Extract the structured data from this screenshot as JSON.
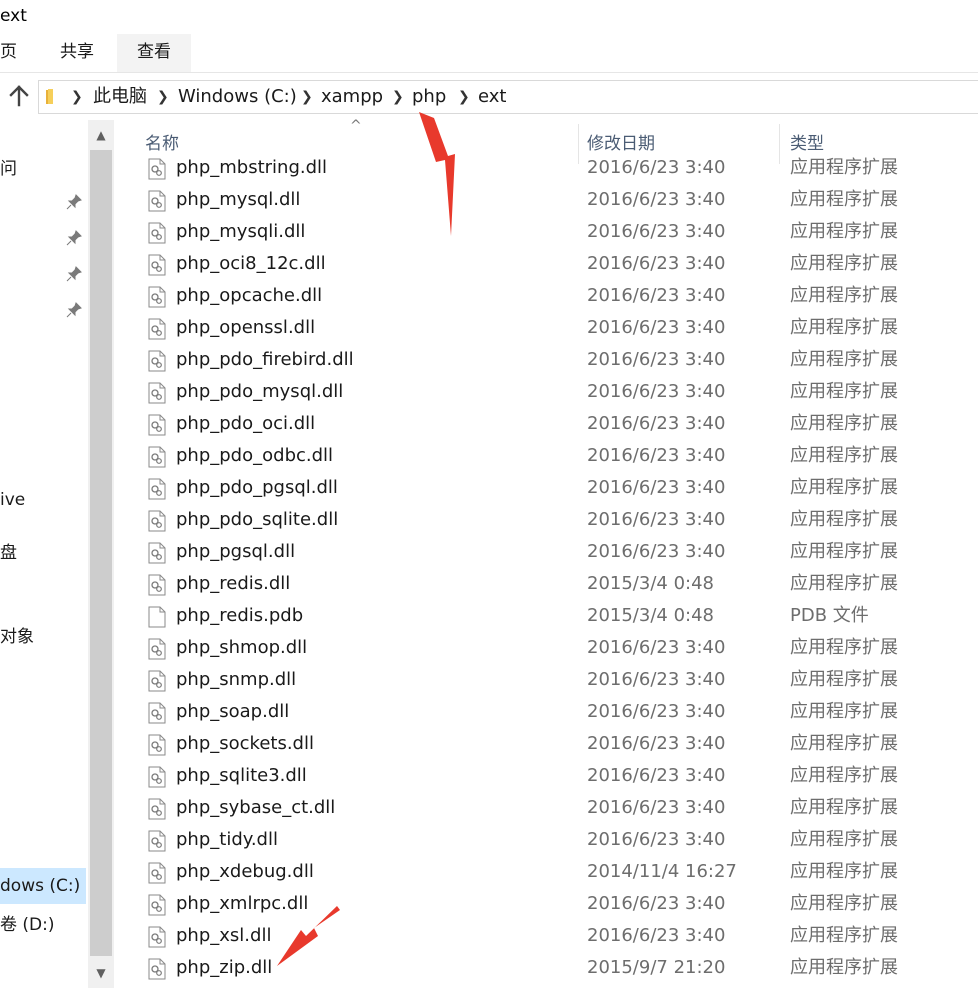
{
  "window": {
    "title": "ext"
  },
  "ribbon": {
    "tabs": [
      {
        "label": "页"
      },
      {
        "label": "共享"
      },
      {
        "label": "查看"
      }
    ]
  },
  "address": {
    "crumbs": [
      {
        "label": "此电脑"
      },
      {
        "label": "Windows (C:)"
      },
      {
        "label": "xampp"
      },
      {
        "label": "php"
      },
      {
        "label": "ext"
      }
    ]
  },
  "sidebar": {
    "items": [
      {
        "label": "问"
      },
      {
        "label": "ive"
      },
      {
        "label": "盘"
      },
      {
        "label": "对象"
      },
      {
        "label": "dows (C:)"
      },
      {
        "label": "卷 (D:)"
      }
    ]
  },
  "columns": {
    "name": "名称",
    "date": "修改日期",
    "type": "类型"
  },
  "files": [
    {
      "name": "php_mbstring.dll",
      "date": "2016/6/23 3:40",
      "type": "应用程序扩展",
      "icon": "dll-file-icon"
    },
    {
      "name": "php_mysql.dll",
      "date": "2016/6/23 3:40",
      "type": "应用程序扩展",
      "icon": "dll-file-icon"
    },
    {
      "name": "php_mysqli.dll",
      "date": "2016/6/23 3:40",
      "type": "应用程序扩展",
      "icon": "dll-file-icon"
    },
    {
      "name": "php_oci8_12c.dll",
      "date": "2016/6/23 3:40",
      "type": "应用程序扩展",
      "icon": "dll-file-icon"
    },
    {
      "name": "php_opcache.dll",
      "date": "2016/6/23 3:40",
      "type": "应用程序扩展",
      "icon": "dll-file-icon"
    },
    {
      "name": "php_openssl.dll",
      "date": "2016/6/23 3:40",
      "type": "应用程序扩展",
      "icon": "dll-file-icon"
    },
    {
      "name": "php_pdo_firebird.dll",
      "date": "2016/6/23 3:40",
      "type": "应用程序扩展",
      "icon": "dll-file-icon"
    },
    {
      "name": "php_pdo_mysql.dll",
      "date": "2016/6/23 3:40",
      "type": "应用程序扩展",
      "icon": "dll-file-icon"
    },
    {
      "name": "php_pdo_oci.dll",
      "date": "2016/6/23 3:40",
      "type": "应用程序扩展",
      "icon": "dll-file-icon"
    },
    {
      "name": "php_pdo_odbc.dll",
      "date": "2016/6/23 3:40",
      "type": "应用程序扩展",
      "icon": "dll-file-icon"
    },
    {
      "name": "php_pdo_pgsql.dll",
      "date": "2016/6/23 3:40",
      "type": "应用程序扩展",
      "icon": "dll-file-icon"
    },
    {
      "name": "php_pdo_sqlite.dll",
      "date": "2016/6/23 3:40",
      "type": "应用程序扩展",
      "icon": "dll-file-icon"
    },
    {
      "name": "php_pgsql.dll",
      "date": "2016/6/23 3:40",
      "type": "应用程序扩展",
      "icon": "dll-file-icon"
    },
    {
      "name": "php_redis.dll",
      "date": "2015/3/4 0:48",
      "type": "应用程序扩展",
      "icon": "dll-file-icon"
    },
    {
      "name": "php_redis.pdb",
      "date": "2015/3/4 0:48",
      "type": "PDB 文件",
      "icon": "blank-file-icon"
    },
    {
      "name": "php_shmop.dll",
      "date": "2016/6/23 3:40",
      "type": "应用程序扩展",
      "icon": "dll-file-icon"
    },
    {
      "name": "php_snmp.dll",
      "date": "2016/6/23 3:40",
      "type": "应用程序扩展",
      "icon": "dll-file-icon"
    },
    {
      "name": "php_soap.dll",
      "date": "2016/6/23 3:40",
      "type": "应用程序扩展",
      "icon": "dll-file-icon"
    },
    {
      "name": "php_sockets.dll",
      "date": "2016/6/23 3:40",
      "type": "应用程序扩展",
      "icon": "dll-file-icon"
    },
    {
      "name": "php_sqlite3.dll",
      "date": "2016/6/23 3:40",
      "type": "应用程序扩展",
      "icon": "dll-file-icon"
    },
    {
      "name": "php_sybase_ct.dll",
      "date": "2016/6/23 3:40",
      "type": "应用程序扩展",
      "icon": "dll-file-icon"
    },
    {
      "name": "php_tidy.dll",
      "date": "2016/6/23 3:40",
      "type": "应用程序扩展",
      "icon": "dll-file-icon"
    },
    {
      "name": "php_xdebug.dll",
      "date": "2014/11/4 16:27",
      "type": "应用程序扩展",
      "icon": "dll-file-icon"
    },
    {
      "name": "php_xmlrpc.dll",
      "date": "2016/6/23 3:40",
      "type": "应用程序扩展",
      "icon": "dll-file-icon"
    },
    {
      "name": "php_xsl.dll",
      "date": "2016/6/23 3:40",
      "type": "应用程序扩展",
      "icon": "dll-file-icon"
    },
    {
      "name": "php_zip.dll",
      "date": "2015/9/7 21:20",
      "type": "应用程序扩展",
      "icon": "dll-file-icon"
    }
  ],
  "colors": {
    "annotation_arrow": "#e8392c",
    "selection": "#cce8ff",
    "header_text": "#4b5c74",
    "secondary_text": "#6d6d6d"
  }
}
